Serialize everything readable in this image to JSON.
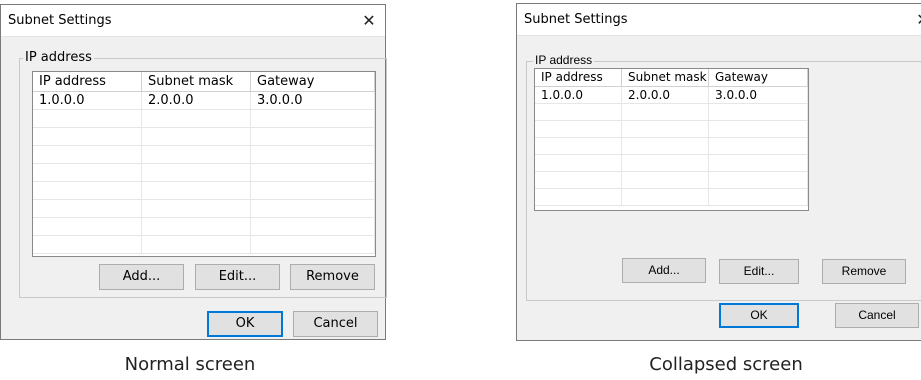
{
  "normal": {
    "title": "Subnet Settings",
    "close_glyph": "✕",
    "group_label": "IP address",
    "columns": [
      "IP address",
      "Subnet mask",
      "Gateway"
    ],
    "rows": [
      [
        "1.0.0.0",
        "2.0.0.0",
        "3.0.0.0"
      ],
      [
        "",
        "",
        ""
      ],
      [
        "",
        "",
        ""
      ],
      [
        "",
        "",
        ""
      ],
      [
        "",
        "",
        ""
      ],
      [
        "",
        "",
        ""
      ],
      [
        "",
        "",
        ""
      ],
      [
        "",
        "",
        ""
      ],
      [
        "",
        "",
        ""
      ]
    ],
    "buttons": {
      "add": "Add...",
      "edit": "Edit...",
      "remove": "Remove",
      "ok": "OK",
      "cancel": "Cancel"
    },
    "caption": "Normal screen"
  },
  "collapsed": {
    "title": "Subnet Settings",
    "close_glyph": "✕",
    "group_label": "IP address",
    "columns": [
      "IP address",
      "Subnet mask",
      "Gateway"
    ],
    "rows": [
      [
        "1.0.0.0",
        "2.0.0.0",
        "3.0.0.0"
      ],
      [
        "",
        "",
        ""
      ],
      [
        "",
        "",
        ""
      ],
      [
        "",
        "",
        ""
      ],
      [
        "",
        "",
        ""
      ],
      [
        "",
        "",
        ""
      ],
      [
        "",
        "",
        ""
      ]
    ],
    "buttons": {
      "add": "Add...",
      "edit": "Edit...",
      "remove": "Remove",
      "ok": "OK",
      "cancel": "Cancel"
    },
    "caption": "Collapsed screen"
  }
}
